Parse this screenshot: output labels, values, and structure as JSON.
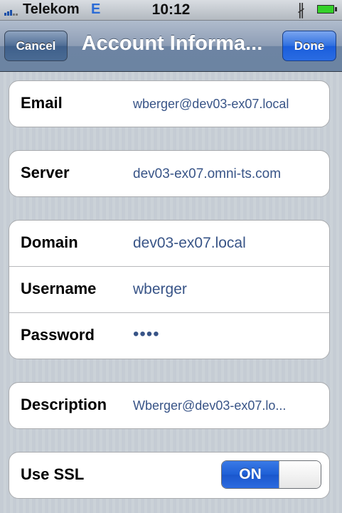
{
  "status_bar": {
    "carrier": "Telekom",
    "network": "E",
    "time": "10:12",
    "bluetooth_icon": "bluetooth-icon",
    "battery_icon": "battery-icon",
    "signal_icon": "signal-bars-icon"
  },
  "nav": {
    "cancel_label": "Cancel",
    "title": "Account Informa...",
    "done_label": "Done"
  },
  "groups": {
    "email": {
      "label": "Email",
      "value": "wberger@dev03-ex07.local"
    },
    "server": {
      "label": "Server",
      "value": "dev03-ex07.omni-ts.com"
    },
    "domain": {
      "label": "Domain",
      "value": "dev03-ex07.local"
    },
    "username": {
      "label": "Username",
      "value": "wberger"
    },
    "password": {
      "label": "Password",
      "value": "••••"
    },
    "description": {
      "label": "Description",
      "value": "Wberger@dev03-ex07.lo..."
    },
    "ssl": {
      "label": "Use SSL",
      "toggle_label": "ON"
    }
  },
  "colors": {
    "value_text": "#385487",
    "toggle_on": "#1e5fd6",
    "done_button": "#2f6fe0"
  }
}
